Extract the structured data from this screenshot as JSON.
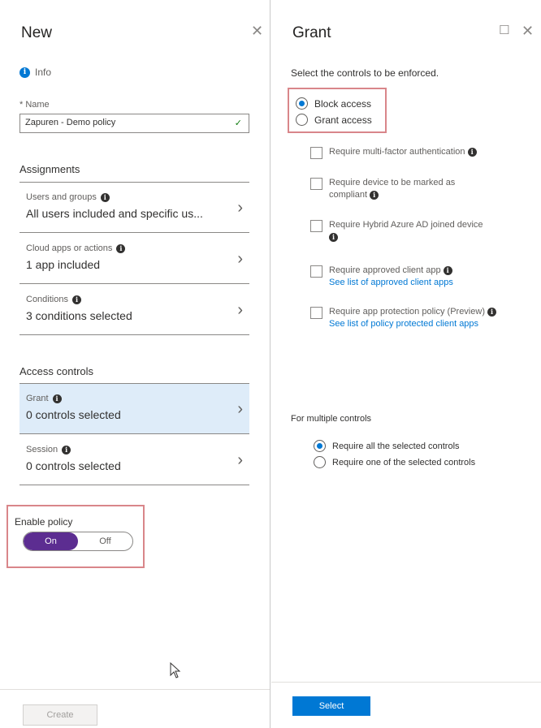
{
  "new_blade": {
    "title": "New",
    "close_glyph": "✕",
    "info_label": "Info",
    "name_label": "* Name",
    "name_value": "Zapuren - Demo policy",
    "assignments_heading": "Assignments",
    "assignments": [
      {
        "label": "Users and groups",
        "value": "All users included and specific us..."
      },
      {
        "label": "Cloud apps or actions",
        "value": "1 app included"
      },
      {
        "label": "Conditions",
        "value": "3 conditions selected"
      }
    ],
    "access_controls_heading": "Access controls",
    "access_controls": [
      {
        "label": "Grant",
        "value": "0 controls selected",
        "selected": true
      },
      {
        "label": "Session",
        "value": "0 controls selected",
        "selected": false
      }
    ],
    "enable_policy_label": "Enable policy",
    "toggle": {
      "on_label": "On",
      "off_label": "Off",
      "state": "On"
    },
    "create_label": "Create"
  },
  "grant_blade": {
    "title": "Grant",
    "maximize_glyph": "☐",
    "close_glyph": "✕",
    "intro": "Select the controls to be enforced.",
    "access_options": [
      {
        "label": "Block access",
        "checked": true
      },
      {
        "label": "Grant access",
        "checked": false
      }
    ],
    "controls": [
      {
        "label": "Require multi-factor authentication",
        "info": true,
        "link": ""
      },
      {
        "label": "Require device to be marked as compliant",
        "info": true,
        "link": ""
      },
      {
        "label": "Require Hybrid Azure AD joined device",
        "info": true,
        "link": ""
      },
      {
        "label": "Require approved client app",
        "info": true,
        "link": "See list of approved client apps"
      },
      {
        "label": "Require app protection policy (Preview)",
        "info": true,
        "link": "See list of policy protected client apps"
      }
    ],
    "multiple_label": "For multiple controls",
    "multiple_options": [
      {
        "label": "Require all the selected controls",
        "checked": true
      },
      {
        "label": "Require one of the selected controls",
        "checked": false
      }
    ],
    "select_label": "Select"
  },
  "colors": {
    "accent": "#0078d4",
    "toggle_on": "#5c2d91",
    "highlight": "#d9868a",
    "selected_bg": "#deecf9"
  }
}
